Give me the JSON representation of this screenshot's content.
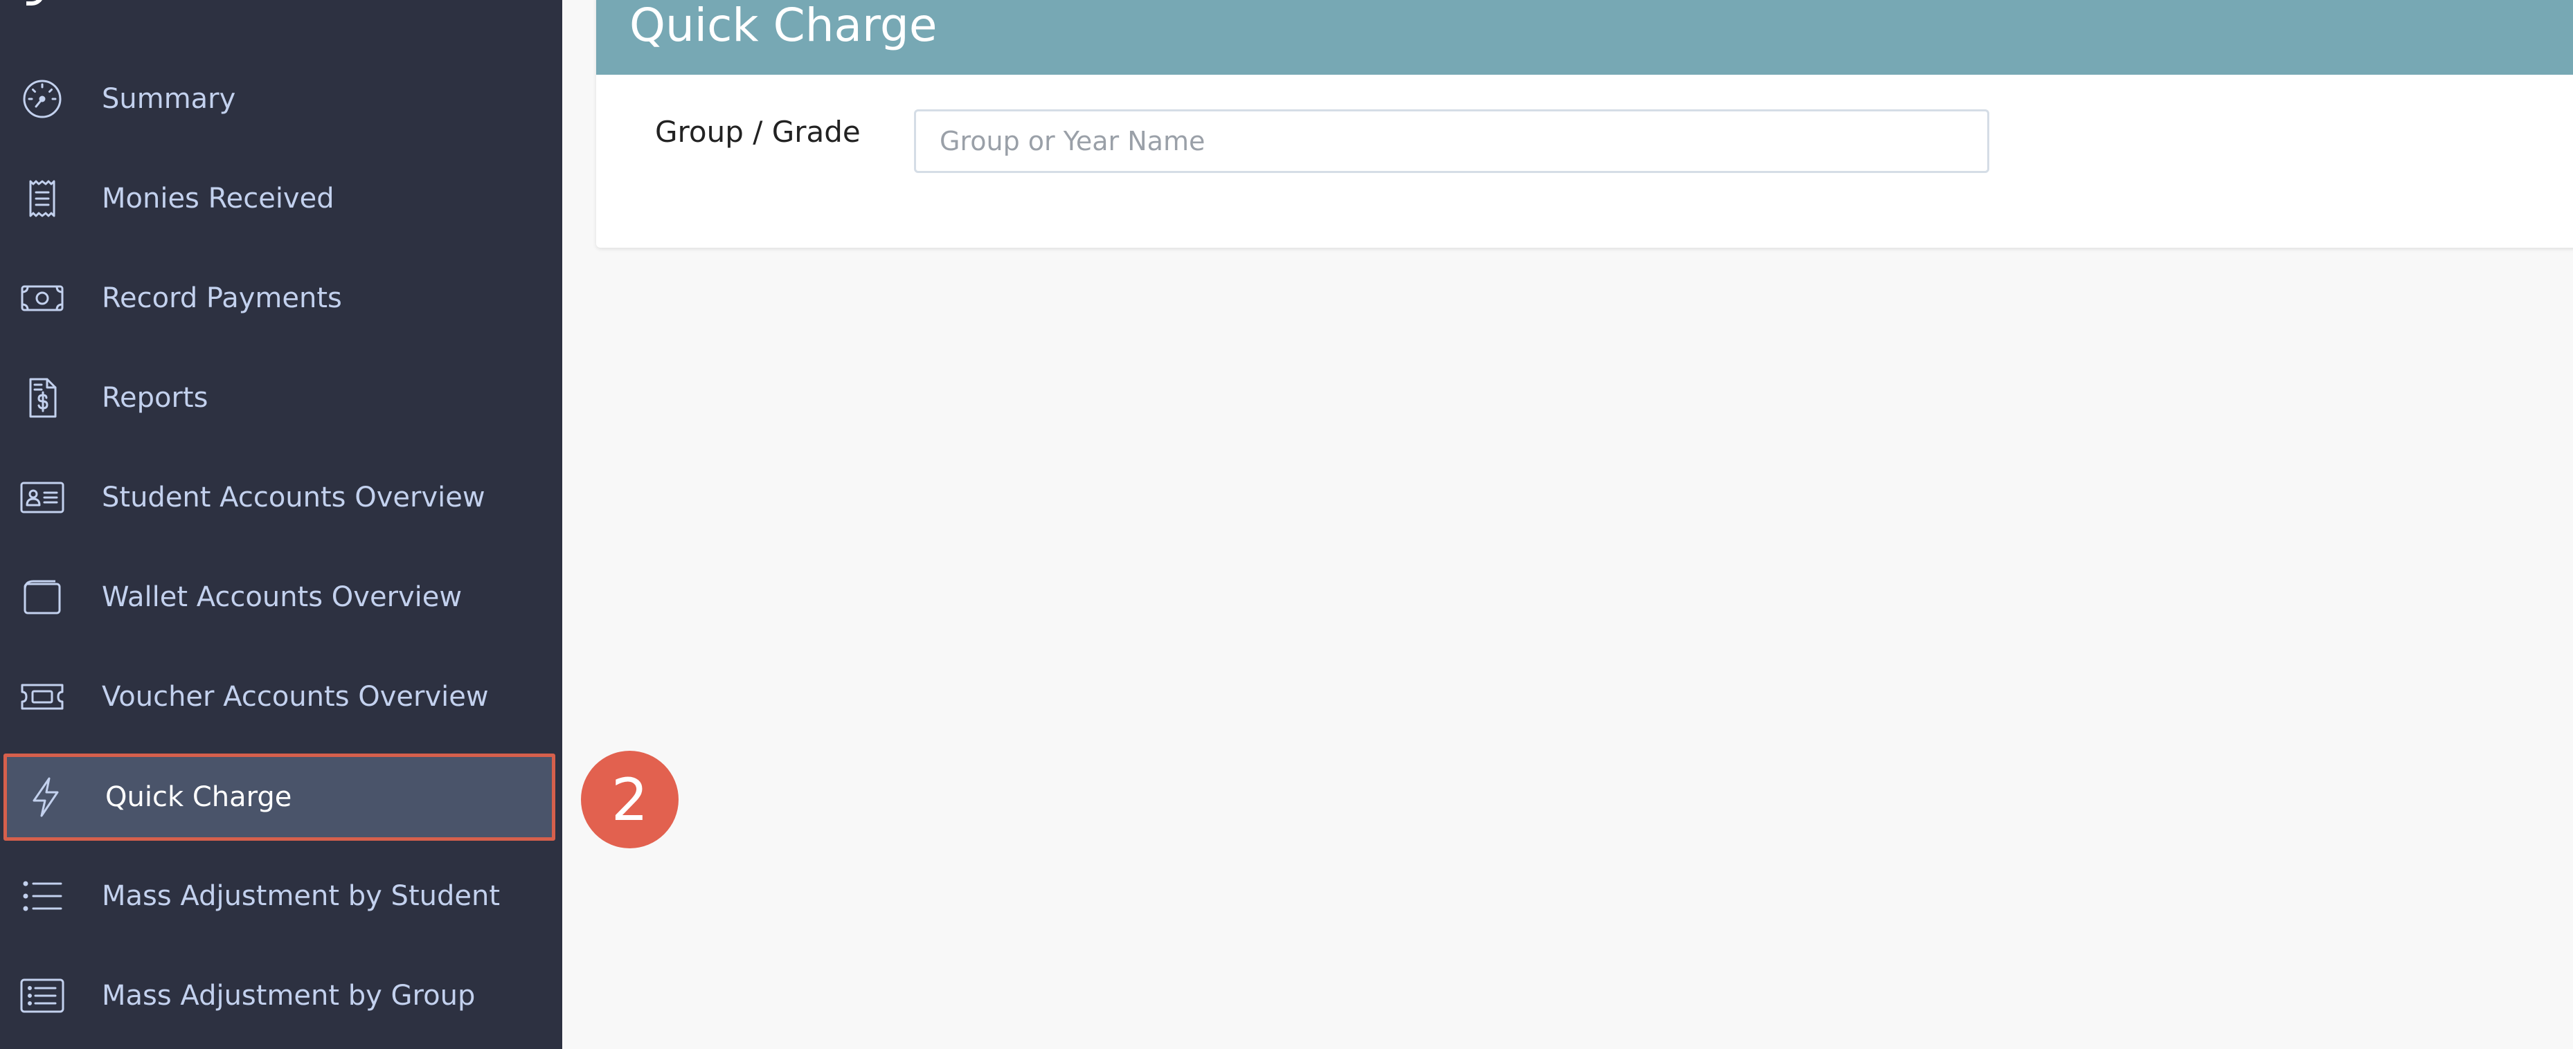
{
  "sidebar": {
    "items": [
      {
        "label": "Summary",
        "icon": "speedometer-icon"
      },
      {
        "label": "Monies Received",
        "icon": "receipt-icon"
      },
      {
        "label": "Record Payments",
        "icon": "banknote-icon"
      },
      {
        "label": "Reports",
        "icon": "invoice-dollar-icon"
      },
      {
        "label": "Student Accounts Overview",
        "icon": "id-card-icon"
      },
      {
        "label": "Wallet Accounts Overview",
        "icon": "wallet-icon"
      },
      {
        "label": "Voucher Accounts Overview",
        "icon": "ticket-icon"
      },
      {
        "label": "Quick Charge",
        "icon": "lightning-icon",
        "active": true
      },
      {
        "label": "Mass Adjustment by Student",
        "icon": "list-icon"
      },
      {
        "label": "Mass Adjustment by Group",
        "icon": "list-box-icon"
      }
    ]
  },
  "annotation": {
    "step_number": "2"
  },
  "main": {
    "title": "Quick Charge",
    "group_field": {
      "label": "Group / Grade",
      "placeholder": "Group or Year Name",
      "value": ""
    }
  },
  "colors": {
    "sidebar_bg": "#2d3141",
    "sidebar_text": "#c3d1ee",
    "active_bg": "#4a546a",
    "highlight_border": "#d6604c",
    "badge": "#e2614f",
    "header": "#77a8b4",
    "page_bg": "#f8f8f8"
  }
}
